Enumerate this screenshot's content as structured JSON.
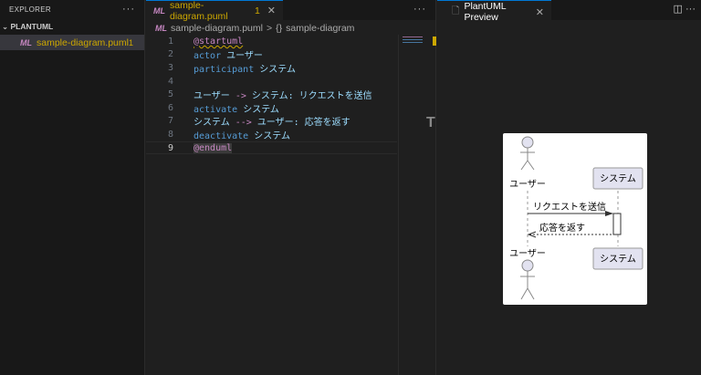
{
  "explorer": {
    "title": "EXPLORER",
    "more": "···",
    "folder": "PLANTUML",
    "file": {
      "name": "sample-diagram.puml",
      "badge": "1",
      "icon": "ML"
    }
  },
  "editor": {
    "tab": {
      "name": "sample-diagram.puml",
      "badge": "1",
      "close": "✕"
    },
    "more": "···",
    "breadcrumb": {
      "file": "sample-diagram.puml",
      "sep": ">",
      "symbol_icon": "{}",
      "symbol": "sample-diagram"
    },
    "lines": [
      {
        "n": "1",
        "a": "@startuml"
      },
      {
        "n": "2",
        "a": "actor",
        "b": " ユーザー"
      },
      {
        "n": "3",
        "a": "participant",
        "b": " システム"
      },
      {
        "n": "4"
      },
      {
        "n": "5",
        "a": "ユーザー",
        "op": " -> ",
        "b": "システム: リクエストを送信"
      },
      {
        "n": "6",
        "a": "activate",
        "b": " システム"
      },
      {
        "n": "7",
        "a": "システム",
        "op": " --> ",
        "b": "ユーザー: 応答を返す"
      },
      {
        "n": "8",
        "a": "deactivate",
        "b": " システム"
      },
      {
        "n": "9",
        "a": "@enduml"
      }
    ]
  },
  "preview": {
    "tab": "PlantUML Preview",
    "close": "✕",
    "split_icon": "◫",
    "more": "···",
    "diagram": {
      "actor": "ユーザー",
      "participant": "システム",
      "msg1": "リクエストを送信",
      "msg2": "応答を返す"
    }
  }
}
